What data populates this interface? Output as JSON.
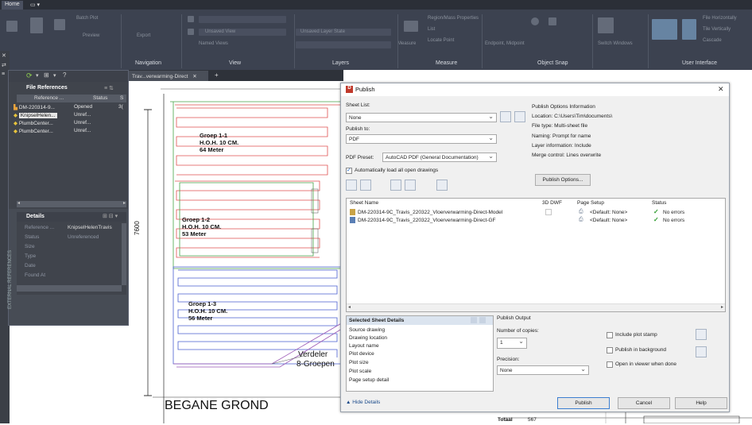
{
  "ribbon": {
    "tabs": [
      "Home",
      "▭ ▾"
    ],
    "faded_labels": [
      "Batch Plot",
      "Preview",
      "Export",
      "Unsaved View",
      "Unsaved Layer State",
      "Named Views",
      "Region/Mass Properties",
      "List",
      "Locate Point",
      "Measure",
      "Endpoint, Midpoint",
      "Switch Windows",
      "File Horizontally",
      "Tile Vertically",
      "Cascade"
    ],
    "panels": [
      "Navigation",
      "View",
      "Layers",
      "Measure",
      "Object Snap",
      "User Interface"
    ]
  },
  "doc_tab": {
    "label": "Trav...verwarming-Direct"
  },
  "file_references": {
    "title": "File References",
    "headers": [
      "Reference ...",
      "Status",
      "S"
    ],
    "items": [
      {
        "name": "DM-220314-9...",
        "status": "Opened",
        "extra": "3("
      },
      {
        "name": "KnipselHelen...",
        "status": "Unref...",
        "extra": ""
      },
      {
        "name": "PlumbCenter...",
        "status": "Unref...",
        "extra": ""
      },
      {
        "name": "PlumbCenter...",
        "status": "Unref...",
        "extra": ""
      }
    ],
    "details_title": "Details",
    "details": [
      {
        "label": "Reference ...",
        "value": "KnipselHelenTravis"
      },
      {
        "label": "Status",
        "value": "Unreferenced"
      },
      {
        "label": "Size",
        "value": ""
      },
      {
        "label": "Type",
        "value": ""
      },
      {
        "label": "Date",
        "value": ""
      },
      {
        "label": "Found At",
        "value": ""
      }
    ],
    "side_label": "EXTERNAL REFERENCES"
  },
  "drawing": {
    "groups": [
      {
        "l1": "Groep 1-1",
        "l2": "H.O.H. 10 CM.",
        "l3": "64 Meter"
      },
      {
        "l1": "Groep 1-2",
        "l2": "H.O.H. 10 CM.",
        "l3": "53 Meter"
      },
      {
        "l1": "Groep 1-3",
        "l2": "H.O.H. 10 CM.",
        "l3": "56 Meter"
      }
    ],
    "dimension": "7600",
    "verdeler_1": "Verdeler",
    "verdeler_2": "8-Groepen",
    "floor_label": "BEGANE GROND",
    "total_label": "Totaal",
    "total_value": "567"
  },
  "dialog": {
    "title": "Publish",
    "close": "✕",
    "sheet_list_label": "Sheet List:",
    "sheet_list_value": "None",
    "publish_to_label": "Publish to:",
    "publish_to_value": "PDF",
    "pdf_preset_label": "PDF Preset:",
    "pdf_preset_value": "AutoCAD PDF (General Documentation)",
    "auto_load_label": "Automatically load all open drawings",
    "info_title": "Publish Options Information",
    "info_lines": [
      "Location: C:\\Users\\Tim\\documents\\",
      "File type: Multi-sheet file",
      "Naming: Prompt for name",
      "Layer information: Include",
      "Merge control: Lines overwrite"
    ],
    "publish_options_btn": "Publish Options...",
    "table_headers": [
      "Sheet Name",
      "3D DWF",
      "Page Setup",
      "Status"
    ],
    "sheets": [
      {
        "name": "DM-220314-9C_Travis_220322_Vloerverwarming-Direct-Model",
        "setup": "<Default: None>",
        "status": "No errors"
      },
      {
        "name": "DM-220314-9C_Travis_220322_Vloerverwarming-Direct-GF",
        "setup": "<Default: None>",
        "status": "No errors"
      }
    ],
    "details_title": "Selected Sheet Details",
    "details_items": [
      "Source drawing",
      "Drawing location",
      "Layout name",
      "Plot device",
      "Plot size",
      "Plot scale",
      "Page setup detail"
    ],
    "output_title": "Publish Output",
    "copies_label": "Number of copies:",
    "copies_value": "1",
    "precision_label": "Precision:",
    "precision_value": "None",
    "plot_stamp_label": "Include plot stamp",
    "background_label": "Publish in background",
    "open_viewer_label": "Open in viewer when done",
    "hide_details": "▲ Hide Details",
    "publish_btn": "Publish",
    "cancel_btn": "Cancel",
    "help_btn": "Help"
  }
}
